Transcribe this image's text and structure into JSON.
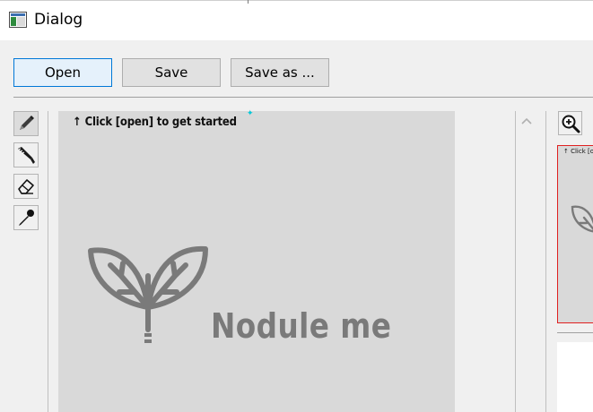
{
  "window": {
    "title": "Dialog",
    "icon": "app-icon"
  },
  "toolbar": {
    "open_label": "Open",
    "save_label": "Save",
    "save_as_label": "Save as ..."
  },
  "tools": [
    {
      "name": "pen-tool",
      "icon": "pen-icon",
      "active": true
    },
    {
      "name": "brush-tool",
      "icon": "brush-icon",
      "active": false
    },
    {
      "name": "eraser-tool",
      "icon": "eraser-icon",
      "active": false
    },
    {
      "name": "eyedropper-tool",
      "icon": "eyedropper-icon",
      "active": false
    }
  ],
  "canvas": {
    "hint_arrow": "↑",
    "hint_text": "Click [open] to get started",
    "brand_name": "Nodule me",
    "brand_color": "#7a7a7a",
    "background": "#d9d9d9"
  },
  "preview": {
    "zoom_icon": "zoom-in-icon",
    "thumbnail_hint": "↑ Click [open",
    "border_color": "#e02020"
  },
  "colors": {
    "accent": "#0078d7",
    "window_bg": "#f0f0f0"
  }
}
